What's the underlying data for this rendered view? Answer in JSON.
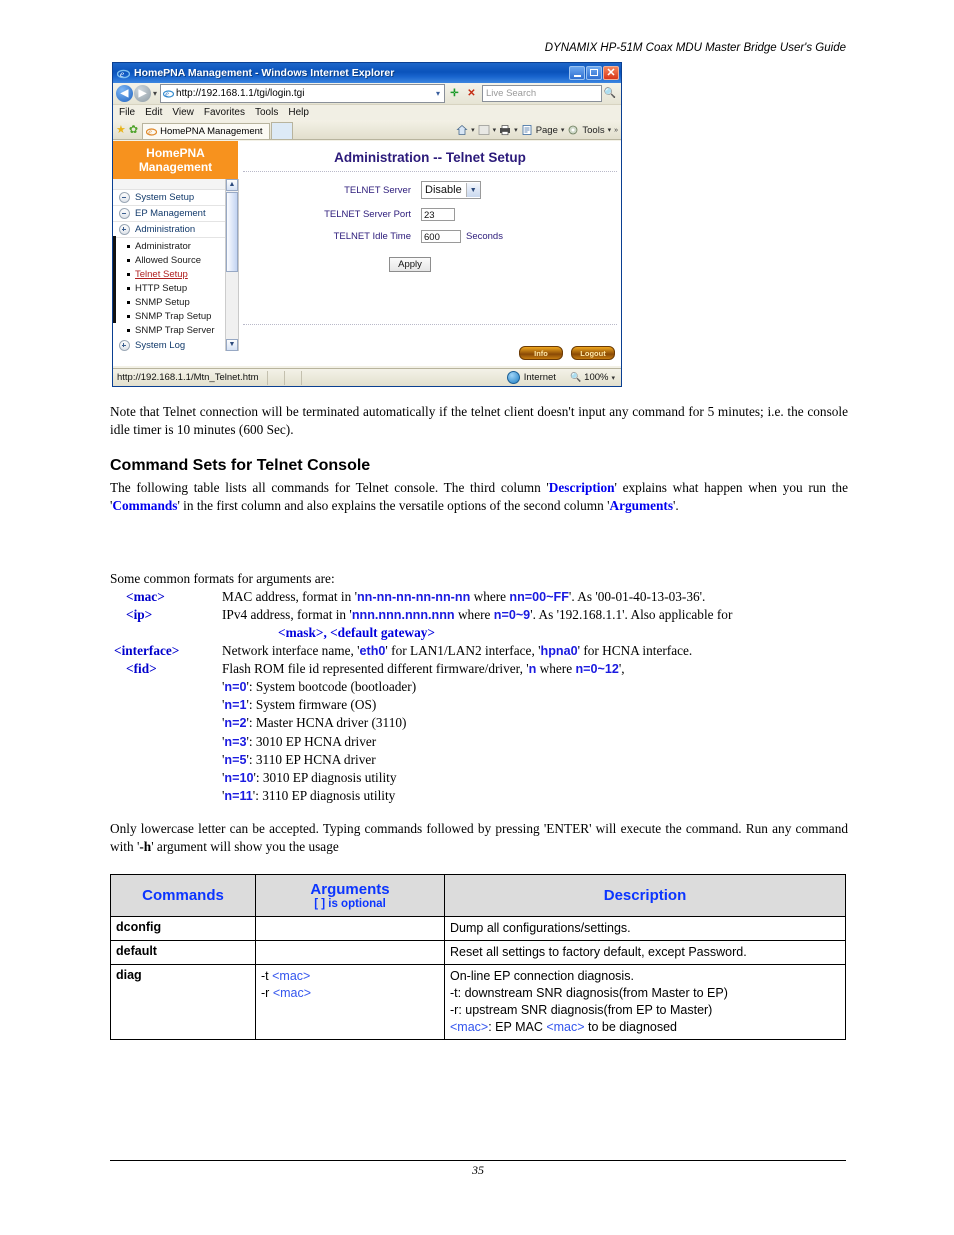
{
  "doc": {
    "running_header": "DYNAMIX HP-51M Coax MDU Master Bridge User's Guide",
    "page_number": "35"
  },
  "browser": {
    "window_title": "HomePNA Management - Windows Internet Explorer",
    "url": "http://192.168.1.1/tgi/login.tgi",
    "search_placeholder": "Live Search",
    "menus": [
      "File",
      "Edit",
      "View",
      "Favorites",
      "Tools",
      "Help"
    ],
    "tab_label": "HomePNA Management",
    "toolbar_right": [
      "Page",
      "Tools"
    ],
    "status_url": "http://192.168.1.1/Mtn_Telnet.htm",
    "status_zone": "Internet",
    "status_zoom": "100%"
  },
  "webui": {
    "brand_line1": "HomePNA",
    "brand_line2": "Management",
    "nav": [
      {
        "label": "System Setup",
        "state": "minus"
      },
      {
        "label": "EP Management",
        "state": "minus"
      },
      {
        "label": "Administration",
        "state": "plus"
      }
    ],
    "subnav": [
      {
        "label": "Administrator",
        "active": false
      },
      {
        "label": "Allowed Source",
        "active": false
      },
      {
        "label": "Telnet Setup",
        "active": true
      },
      {
        "label": "HTTP Setup",
        "active": false
      },
      {
        "label": "SNMP Setup",
        "active": false
      },
      {
        "label": "SNMP Trap Setup",
        "active": false
      },
      {
        "label": "SNMP Trap Server",
        "active": false
      }
    ],
    "nav_last": {
      "label": "System Log",
      "state": "plus"
    },
    "page_title": "Administration -- Telnet Setup",
    "fields": [
      {
        "label": "TELNET Server",
        "value": "Disable",
        "type": "select"
      },
      {
        "label": "TELNET Server Port",
        "value": "23",
        "type": "text"
      },
      {
        "label": "TELNET Idle Time",
        "value": "600",
        "type": "text",
        "unit": "Seconds"
      }
    ],
    "apply_label": "Apply",
    "info_label": "Info",
    "logout_label": "Logout"
  },
  "body": {
    "note": "Note that Telnet connection will be terminated automatically if the telnet client doesn't input any command for 5 minutes; i.e. the console idle timer is 10 minutes (600 Sec).",
    "heading": "Command Sets for Telnet Console",
    "intro_1": "The following table lists all commands for Telnet console. The third column '",
    "intro_desc": "Description",
    "intro_2": "' explains what happen when you run the '",
    "intro_commands": "Commands",
    "intro_3": "' in the first column and  also explains the versatile options of the second column '",
    "intro_arguments": "Arguments",
    "intro_4": "'.",
    "formats_lead": "Some common formats for arguments are:",
    "lowercase_note_1": "Only lowercase letter can be accepted. Typing commands followed by pressing 'ENTER' will execute the command. Run any command with '",
    "lowercase_note_h": "-h",
    "lowercase_note_2": "' argument will show you the usage"
  },
  "arguments": [
    {
      "term": "<mac>",
      "prefix": "MAC address, format in '",
      "code": "nn-nn-nn-nn-nn-nn",
      "mid": " where ",
      "code2": "nn=00~FF",
      "suffix": "'. As '00-01-40-13-03-36'."
    },
    {
      "term": "<ip>",
      "prefix": "IPv4 address, format in '",
      "code": "nnn.nnn.nnn.nnn",
      "mid": " where ",
      "code2": "n=0~9",
      "suffix": "'. As '192.168.1.1'. Also applicable for",
      "continuation": "<mask>, <default gateway>"
    },
    {
      "term": "<interface>",
      "prefix": "Network interface name, '",
      "code": "eth0",
      "mid": "' for LAN1/LAN2 interface, '",
      "code2": "hpna0",
      "suffix": "' for HCNA interface."
    },
    {
      "term": "<fid>",
      "prefix": "Flash ROM file id represented different firmware/driver, '",
      "code": "n",
      "mid": " where ",
      "code2": "n=0~12",
      "suffix": "',"
    }
  ],
  "fid_values": [
    {
      "n": "n=0",
      "text": ": System bootcode (bootloader)"
    },
    {
      "n": "n=1",
      "text": ": System firmware (OS)"
    },
    {
      "n": "n=2",
      "text": ": Master HCNA driver (3110)"
    },
    {
      "n": "n=3",
      "text": ": 3010 EP HCNA driver"
    },
    {
      "n": "n=5",
      "text": ": 3110 EP HCNA driver"
    },
    {
      "n": "n=10",
      "text": ": 3010 EP diagnosis utility"
    },
    {
      "n": "n=11",
      "text": ": 3110 EP diagnosis utility"
    }
  ],
  "table": {
    "headers": {
      "commands": "Commands",
      "arguments": "Arguments",
      "arguments_sub": "[ ] is optional",
      "description": "Description"
    },
    "rows": [
      {
        "command": "dconfig",
        "arguments": [],
        "description": [
          "Dump all configurations/settings."
        ]
      },
      {
        "command": "default",
        "arguments": [],
        "description": [
          "Reset all settings to factory default, except Password."
        ]
      },
      {
        "command": "diag",
        "arguments": [
          "-t <mac>",
          "-r <mac>"
        ],
        "description": [
          "On-line EP connection diagnosis.",
          "-t: downstream SNR diagnosis(from Master to EP)",
          "-r: upstream SNR diagnosis(from EP to Master)",
          "<mac>: EP MAC <mac> to be diagnosed"
        ]
      }
    ]
  },
  "colors": {
    "brand_orange": "#f7921e",
    "heading_navy": "#2b1a7a",
    "link_blue": "#0000ee",
    "table_header_bg": "#dcdcdc",
    "table_header_text": "#0b35ff",
    "active_nav_red": "#b02020"
  }
}
